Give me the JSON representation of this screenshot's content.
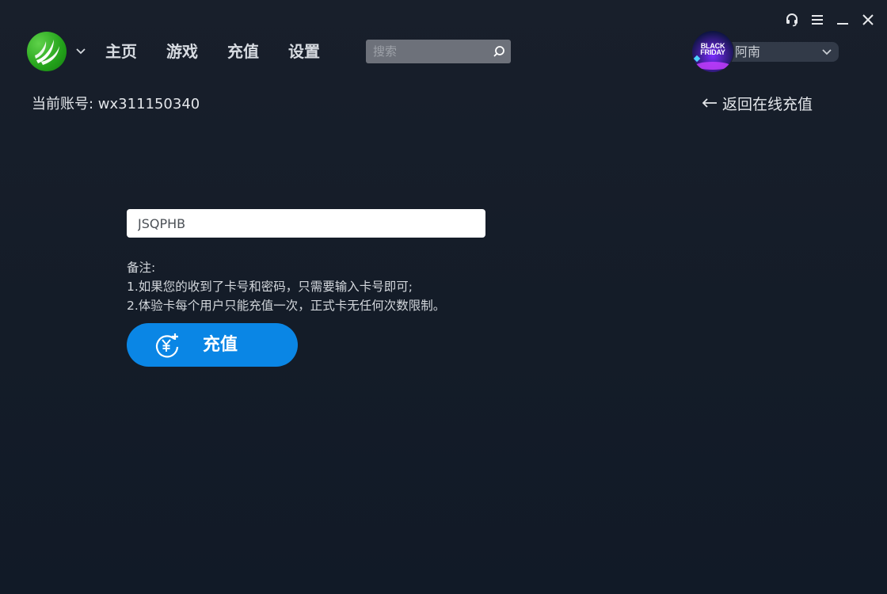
{
  "window_controls": {
    "support": "headset-icon",
    "menu": "menu-icon",
    "minimize": "minimize-icon",
    "close": "close-icon"
  },
  "nav": {
    "items": [
      {
        "label": "主页"
      },
      {
        "label": "游戏"
      },
      {
        "label": "充值"
      },
      {
        "label": "设置"
      }
    ]
  },
  "search": {
    "placeholder": "搜索",
    "value": ""
  },
  "region": {
    "badge_line1": "BLACK",
    "badge_line2": "FRIDAY",
    "selected": "阿南"
  },
  "account": {
    "label": "当前账号: wx311150340"
  },
  "back_link": {
    "label": "返回在线充值"
  },
  "card": {
    "value": "JSQPHB"
  },
  "notes": {
    "title": "备注:",
    "line1": "1.如果您的收到了卡号和密码，只需要输入卡号即可;",
    "line2": "2.体验卡每个用户只能充值一次，正式卡无任何次数限制。"
  },
  "recharge_button": {
    "label": "充值"
  },
  "colors": {
    "background": "#161e2a",
    "accent_blue": "#0a86e5",
    "logo_green": "#23a21a",
    "search_bg": "#6d717a",
    "region_bg": "#323a48"
  }
}
